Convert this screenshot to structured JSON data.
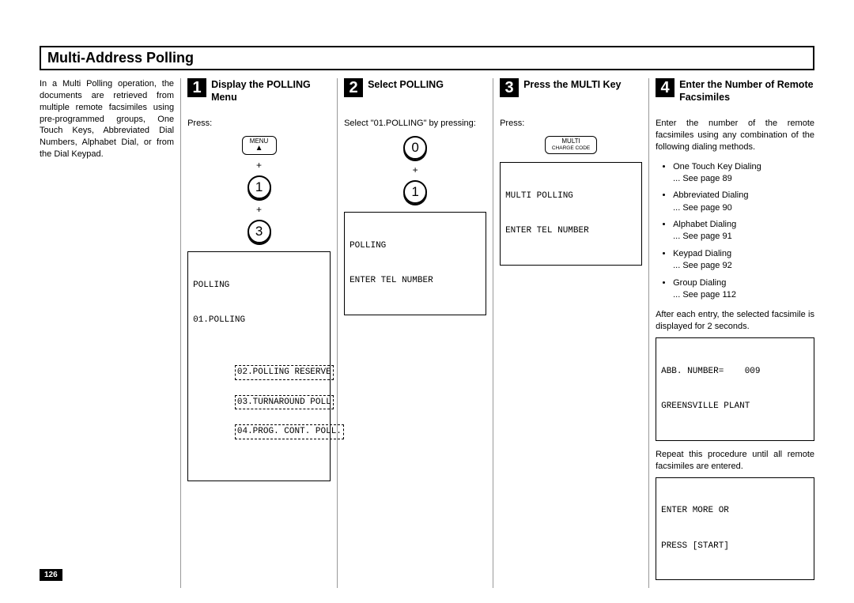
{
  "title": "Multi-Address Polling",
  "page_number": "126",
  "intro": "In a Multi Polling operation, the documents are retrieved from multiple remote facsimiles using pre-programmed groups, One Touch Keys, Abbreviated Dial Numbers, Alphabet Dial, or from the Dial Keypad.",
  "steps": {
    "s1": {
      "num": "1",
      "title": "Display the POLLING Menu",
      "press": "Press:",
      "menu_key_top": "MENU",
      "menu_key_arrow": "▲",
      "plus": "+",
      "btn1": "1",
      "btn3": "3",
      "display_line1": "POLLING",
      "display_line2": "01.POLLING",
      "dash1": "02.POLLING RESERVE",
      "dash2": "03.TURNAROUND POLL",
      "dash3": "04.PROG. CONT. POLL."
    },
    "s2": {
      "num": "2",
      "title": "Select POLLING",
      "instr": "Select \"01.POLLING\" by pressing:",
      "btn0": "0",
      "plus": "+",
      "btn1": "1",
      "display_line1": "POLLING",
      "display_line2": "ENTER TEL NUMBER"
    },
    "s3": {
      "num": "3",
      "title": "Press the MULTI Key",
      "press": "Press:",
      "key_top": "MULTI",
      "key_bottom": "CHARGE CODE",
      "display_line1": "MULTI POLLING",
      "display_line2": "ENTER TEL NUMBER"
    },
    "s4": {
      "num": "4",
      "title": "Enter the Number of Remote Facsimiles",
      "intro": "Enter the number of the remote facsimiles using any combination of the following dialing methods.",
      "list": [
        {
          "t": "One Touch Key Dialing",
          "p": "... See page 89"
        },
        {
          "t": "Abbreviated Dialing",
          "p": "... See page 90"
        },
        {
          "t": "Alphabet Dialing",
          "p": "... See page 91"
        },
        {
          "t": "Keypad Dialing",
          "p": "... See page 92"
        },
        {
          "t": "Group Dialing",
          "p": "... See page 112"
        }
      ],
      "after": "After each entry, the selected facsimile is displayed for 2 seconds.",
      "displayA_line1": "ABB. NUMBER=    009",
      "displayA_line2": "GREENSVILLE PLANT",
      "repeat": "Repeat this procedure until all remote facsimiles are entered.",
      "displayB_line1": "ENTER MORE OR",
      "displayB_line2": "PRESS [START]"
    }
  }
}
